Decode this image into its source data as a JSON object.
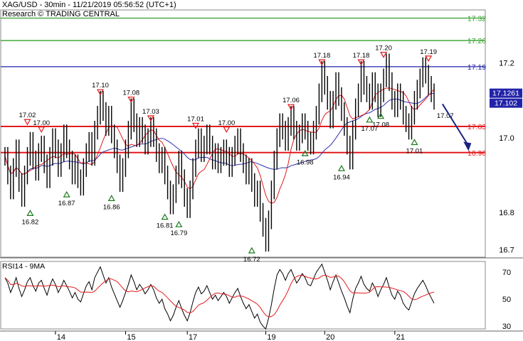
{
  "header": {
    "title": "XAG/USD - 30min - 11/21/2019 05:56:52 (UTC+1)",
    "source": "Research © TRADING CENTRAL"
  },
  "chart_data": [
    {
      "type": "line",
      "name": "price",
      "ylim": [
        16.68,
        17.34
      ],
      "y_ticks": [
        16.7,
        16.8,
        17.0,
        17.2
      ],
      "x_ticks": [
        "14",
        "15",
        "17",
        "19",
        "20",
        "21"
      ],
      "price_values": [
        16.95,
        16.9,
        16.86,
        16.92,
        16.97,
        16.88,
        16.84,
        16.9,
        16.95,
        16.99,
        16.94,
        16.91,
        16.96,
        16.98,
        16.93,
        16.89,
        16.95,
        17.0,
        16.97,
        16.92,
        16.96,
        17.01,
        16.97,
        16.94,
        16.9,
        16.93,
        16.89,
        16.87,
        16.92,
        16.96,
        16.99,
        16.95,
        17.02,
        17.06,
        17.1,
        17.07,
        17.03,
        17.06,
        17.01,
        16.97,
        16.93,
        16.88,
        16.92,
        16.97,
        17.02,
        17.08,
        17.04,
        17.0,
        17.03,
        17.01,
        16.98,
        17.0,
        17.03,
        17.0,
        16.96,
        16.93,
        16.95,
        16.9,
        16.86,
        16.82,
        16.85,
        16.9,
        16.94,
        16.89,
        16.84,
        16.81,
        16.86,
        16.92,
        16.97,
        17.0,
        16.96,
        16.98,
        17.01,
        16.98,
        16.94,
        16.96,
        16.93,
        16.95,
        16.97,
        16.95,
        16.92,
        16.95,
        16.98,
        17.0,
        16.96,
        16.93,
        16.9,
        16.92,
        16.88,
        16.84,
        16.86,
        16.8,
        16.76,
        16.72,
        16.78,
        16.86,
        16.94,
        17.0,
        17.04,
        17.02,
        16.99,
        17.03,
        17.06,
        17.02,
        16.99,
        17.01,
        17.04,
        17.02,
        16.99,
        16.98,
        17.02,
        17.06,
        17.12,
        17.18,
        17.14,
        17.1,
        17.05,
        17.1,
        17.15,
        17.11,
        17.07,
        17.03,
        16.98,
        16.94,
        17.02,
        17.08,
        17.12,
        17.18,
        17.14,
        17.12,
        17.1,
        17.15,
        17.12,
        17.08,
        17.12,
        17.16,
        17.2,
        17.15,
        17.1,
        17.08,
        17.12,
        17.1,
        17.06,
        17.04,
        17.02,
        17.06,
        17.1,
        17.13,
        17.16,
        17.19,
        17.17,
        17.14,
        17.12,
        17.1
      ],
      "bands": [
        {
          "price": 17.32,
          "label": "17.32",
          "color": "#33a02c",
          "kind": "target"
        },
        {
          "price": 17.26,
          "label": "17.26",
          "color": "#33a02c",
          "kind": "target"
        },
        {
          "price": 17.19,
          "label": "17.19",
          "color": "#2222aa",
          "kind": "pivot"
        },
        {
          "price": 17.03,
          "label": "17.03",
          "color": "#e31a1c",
          "kind": "support"
        },
        {
          "price": 16.96,
          "label": "16.96",
          "color": "#e31a1c",
          "kind": "support"
        }
      ],
      "price_badges": [
        {
          "label": "17.1261",
          "bg": "#2222aa",
          "fg": "#ffffff"
        },
        {
          "label": "17.102",
          "bg": "#2222aa",
          "fg": "#ffffff"
        }
      ],
      "highs": [
        {
          "idx": 8,
          "price": 17.02,
          "label": "17.02"
        },
        {
          "idx": 13,
          "price": 17.0,
          "label": "17.00"
        },
        {
          "idx": 34,
          "price": 17.1,
          "label": "17.10"
        },
        {
          "idx": 45,
          "price": 17.08,
          "label": "17.08"
        },
        {
          "idx": 52,
          "price": 17.03,
          "label": "17.03"
        },
        {
          "idx": 68,
          "price": 17.01,
          "label": "17.01"
        },
        {
          "idx": 79,
          "price": 17.0,
          "label": "17.00"
        },
        {
          "idx": 102,
          "price": 17.06,
          "label": "17.06"
        },
        {
          "idx": 113,
          "price": 17.18,
          "label": "17.18"
        },
        {
          "idx": 127,
          "price": 17.18,
          "label": "17.18"
        },
        {
          "idx": 135,
          "price": 17.2,
          "label": "17.20"
        },
        {
          "idx": 151,
          "price": 17.19,
          "label": "17.19"
        }
      ],
      "lows": [
        {
          "idx": 9,
          "price": 16.82,
          "label": "16.82"
        },
        {
          "idx": 22,
          "price": 16.87,
          "label": "16.87"
        },
        {
          "idx": 38,
          "price": 16.86,
          "label": "16.86"
        },
        {
          "idx": 57,
          "price": 16.81,
          "label": "16.81"
        },
        {
          "idx": 62,
          "price": 16.79,
          "label": "16.79"
        },
        {
          "idx": 88,
          "price": 16.72,
          "label": "16.72"
        },
        {
          "idx": 107,
          "price": 16.98,
          "label": "16.98"
        },
        {
          "idx": 120,
          "price": 16.94,
          "label": "16.94"
        },
        {
          "idx": 130,
          "price": 17.07,
          "label": "17.07"
        },
        {
          "idx": 134,
          "price": 17.08,
          "label": "17.08"
        },
        {
          "idx": 146,
          "price": 17.01,
          "label": "17.01"
        }
      ],
      "annotations": [
        {
          "text": "17.07",
          "price": 17.06,
          "idx": 157
        }
      ],
      "forecast_arrow": {
        "from_idx": 156,
        "from_price": 17.09,
        "to_idx": 165,
        "to_price": 16.97,
        "color": "#1a237e"
      }
    },
    {
      "type": "line",
      "title": "RSI14 - 9MA",
      "ylim": [
        28,
        78
      ],
      "y_ticks": [
        30,
        50,
        70
      ],
      "values": [
        66,
        62,
        55,
        60,
        66,
        58,
        52,
        57,
        63,
        66,
        60,
        56,
        62,
        64,
        58,
        53,
        60,
        65,
        61,
        55,
        59,
        64,
        60,
        56,
        51,
        55,
        50,
        48,
        54,
        60,
        63,
        57,
        66,
        70,
        74,
        68,
        62,
        66,
        59,
        54,
        49,
        44,
        49,
        55,
        61,
        68,
        63,
        57,
        61,
        58,
        54,
        57,
        61,
        57,
        51,
        47,
        50,
        43,
        39,
        34,
        38,
        44,
        49,
        43,
        38,
        34,
        40,
        48,
        55,
        59,
        54,
        56,
        60,
        55,
        50,
        53,
        49,
        52,
        55,
        52,
        47,
        51,
        55,
        58,
        52,
        47,
        43,
        46,
        41,
        36,
        39,
        33,
        30,
        28,
        36,
        46,
        58,
        68,
        72,
        69,
        64,
        69,
        72,
        67,
        62,
        65,
        69,
        66,
        61,
        60,
        65,
        70,
        73,
        76,
        70,
        64,
        57,
        63,
        68,
        62,
        56,
        51,
        45,
        40,
        50,
        58,
        62,
        67,
        61,
        58,
        56,
        62,
        58,
        52,
        57,
        61,
        66,
        59,
        53,
        50,
        56,
        53,
        47,
        44,
        42,
        48,
        54,
        58,
        61,
        64,
        60,
        55,
        51,
        47
      ]
    }
  ]
}
